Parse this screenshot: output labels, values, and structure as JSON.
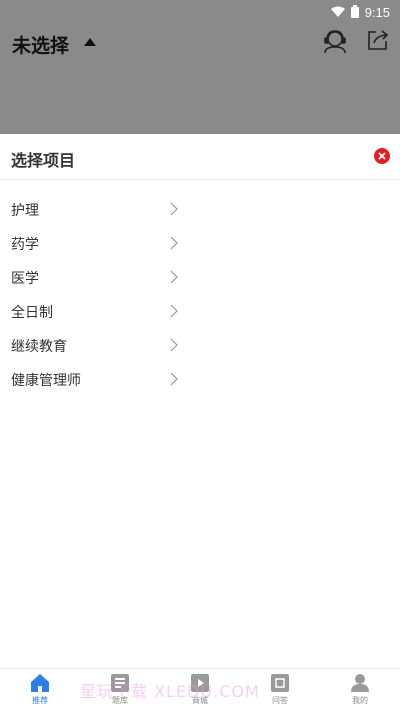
{
  "status_bar": {
    "time": "9:15",
    "wifi_icon": "wifi-icon",
    "battery_icon": "battery-icon"
  },
  "header": {
    "title": "未选择",
    "caret_icon": "caret-up-icon",
    "service_icon": "customer-service-icon",
    "share_icon": "share-icon"
  },
  "sheet": {
    "title": "选择项目",
    "close_icon": "close-icon",
    "items": [
      {
        "label": "护理"
      },
      {
        "label": "药学"
      },
      {
        "label": "医学"
      },
      {
        "label": "全日制"
      },
      {
        "label": "继续教育"
      },
      {
        "label": "健康管理师"
      }
    ]
  },
  "tabbar": {
    "tabs": [
      {
        "label": "推荐",
        "icon": "home-icon",
        "active": true
      },
      {
        "label": "题库",
        "icon": "question-bank-icon",
        "active": false
      },
      {
        "label": "商城",
        "icon": "video-icon",
        "active": false
      },
      {
        "label": "问答",
        "icon": "qa-icon",
        "active": false
      },
      {
        "label": "我的",
        "icon": "user-icon",
        "active": false
      }
    ]
  },
  "watermark": "星玩下载 XLEDU.COM",
  "colors": {
    "accent": "#2f7ee6",
    "close": "#e02020",
    "overlay": "#8a8a8a"
  }
}
